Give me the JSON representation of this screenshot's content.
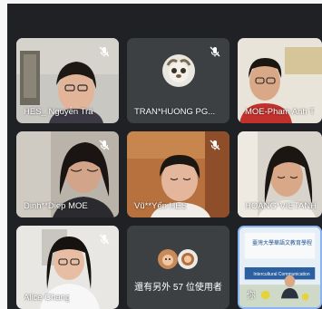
{
  "participants": [
    {
      "name": "HES_ Nguyễn Trâ",
      "muted": true
    },
    {
      "name": "TRAN*HUONG PG...",
      "muted": true
    },
    {
      "name": "MOE-Pham Anh T",
      "muted": true
    },
    {
      "name": "Dinh**Diep MOE",
      "muted": true
    },
    {
      "name": "Vũ**Yến HES",
      "muted": true
    },
    {
      "name": "HOANG*VIETANH",
      "muted": true
    },
    {
      "name": "Alice Chang",
      "muted": true
    },
    {
      "name": "你",
      "muted": false
    }
  ],
  "others": {
    "label": "還有另外 57 位使用者"
  },
  "screen_share": {
    "title": "臺灣大學華語文教育學程",
    "subtitle": "Intercultural Communication"
  },
  "icons": {
    "mute": "mic-off-icon"
  },
  "colors": {
    "background": "#202124",
    "tile": "#3c4043"
  }
}
